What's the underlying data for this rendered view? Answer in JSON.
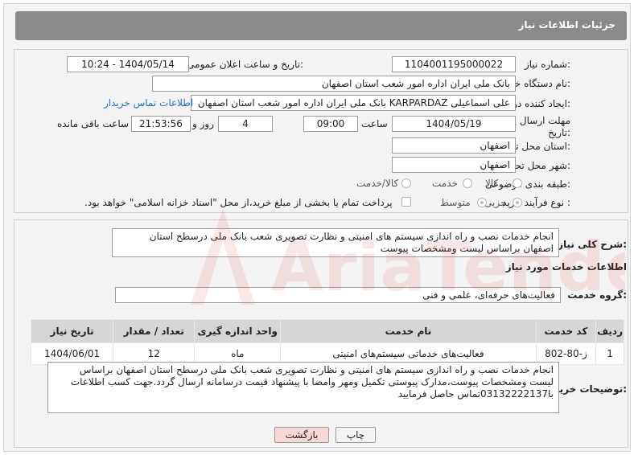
{
  "header": {
    "title": "جزئیات اطلاعات نیاز"
  },
  "fields": {
    "need_number_label": "شماره نیاز:",
    "need_number": "1104001195000022",
    "announce_label": "تاریخ و ساعت اعلان عمومی:",
    "announce_value": "1404/05/14 - 10:24",
    "buyer_label": "نام دستگاه خریدار:",
    "buyer_value": "بانک ملی ایران اداره امور شعب استان اصفهان",
    "creator_label": "ایجاد کننده درخواست:",
    "creator_value": "علی اسماعیلی KARPARDAZ بانک ملی ایران اداره امور شعب استان اصفهان",
    "contact_link": "اطلاعات تماس خریدار",
    "deadline_label_1": "مهلت ارسال پاسخ: تا",
    "deadline_label_2": "تاریخ:",
    "deadline_date": "1404/05/19",
    "time_label": "ساعت",
    "deadline_time": "09:00",
    "days_value": "4",
    "days_label": "روز و",
    "remaining_time": "21:53:56",
    "remaining_label": "ساعت باقی مانده",
    "province_label": "استان محل تحویل:",
    "province_value": "اصفهان",
    "city_label": "شهر محل تحویل:",
    "city_value": "اصفهان",
    "category_label": "طبقه بندی موضوعی:",
    "category_options": [
      "کالا",
      "خدمت",
      "کالا/خدمت"
    ],
    "process_label": "نوع فرآیند خرید :",
    "process_options": [
      "جزیی",
      "متوسط"
    ],
    "payment_text": "پرداخت تمام یا بخشی از مبلغ خرید،از محل \"اسناد خزانه اسلامی\" خواهد بود."
  },
  "description": {
    "label": "شرح کلی نیاز:",
    "text": "انجام خدمات نصب و راه اندازی سیستم های امنیتی و نظارت تصویری شعب بانک ملی درسطح استان اصفهان براساس لیست ومشخصات پیوست"
  },
  "services": {
    "section_title": "اطلاعات خدمات مورد نیاز",
    "group_label": "گروه خدمت:",
    "group_value": "فعالیت‌های حرفه‌ای، علمی و فنی",
    "columns": [
      "ردیف",
      "کد خدمت",
      "نام خدمت",
      "واحد اندازه گیری",
      "تعداد / مقدار",
      "تاریخ نیاز"
    ],
    "rows": [
      {
        "row": "1",
        "code": "ز-80-802",
        "name": "فعالیت‌های خدماتی سیستم‌های امنیتی",
        "unit": "ماه",
        "qty": "12",
        "date": "1404/06/01"
      }
    ]
  },
  "buyer_notes": {
    "label": "توضیحات خریدار:",
    "text": "انجام خدمات نصب و راه اندازی سیستم های امنیتی و نظارت تصویری شعب بانک ملی درسطح استان اصفهان براساس لیست ومشخصات پیوست،مدارک پیوستی تکمیل ومهر وامضا با پیشنهاد قیمت درسامانه ارسال گردد.جهت کسب اطلاعات با03132222137تماس حاصل فرمایید"
  },
  "buttons": {
    "print": "چاپ",
    "back": "بازگشت"
  },
  "watermark": "AriaTender.net",
  "colors": {
    "header": "#8a8a8a",
    "link": "#1e6fd1",
    "back_btn": "#f8d7d7",
    "watermark": "#e05050"
  }
}
